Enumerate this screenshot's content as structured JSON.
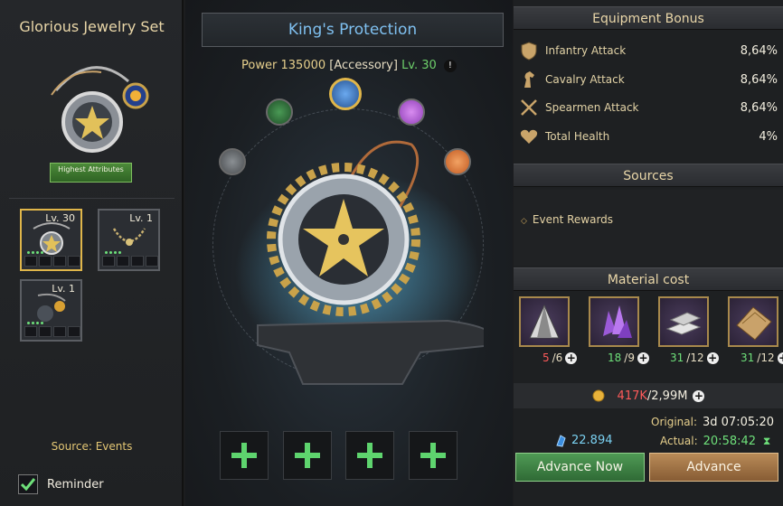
{
  "left_panel": {
    "title": "Glorious Jewelry Set",
    "badge": "Highest Attributes",
    "slots": [
      {
        "level": "Lv. 30",
        "active": true
      },
      {
        "level": "Lv. 1",
        "active": false
      },
      {
        "level": "Lv. 1",
        "active": false
      }
    ],
    "source": "Source: Events",
    "reminder_label": "Reminder",
    "reminder_checked": true
  },
  "center_panel": {
    "item_name": "King's Protection",
    "power_label": "Power",
    "power_value": "135000",
    "category": "[Accessory]",
    "level": "Lv. 30",
    "info_icon": "!",
    "gems": [
      {
        "name": "bronze-star-gem",
        "color": "#6b6f73"
      },
      {
        "name": "green-star-gem",
        "color": "#2f6e3a"
      },
      {
        "name": "blue-star-gem",
        "color": "#3d7cc2"
      },
      {
        "name": "purple-gem",
        "color": "#b45fd6"
      },
      {
        "name": "orange-gem",
        "color": "#e07b3a"
      }
    ],
    "add_slots": 4
  },
  "right_panel": {
    "equipment_bonus_title": "Equipment Bonus",
    "bonuses": [
      {
        "icon": "shield-icon",
        "name": "Infantry Attack",
        "value": "8,64%"
      },
      {
        "icon": "horse-icon",
        "name": "Cavalry Attack",
        "value": "8,64%"
      },
      {
        "icon": "crossed-spears-icon",
        "name": "Spearmen Attack",
        "value": "8,64%"
      },
      {
        "icon": "heart-icon",
        "name": "Total Health",
        "value": "4%"
      }
    ],
    "sources_title": "Sources",
    "source_item": "Event Rewards",
    "material_title": "Material cost",
    "materials": [
      {
        "icon": "ore-icon",
        "have": "5",
        "need": "/6",
        "enough": false
      },
      {
        "icon": "crystal-icon",
        "have": "18",
        "need": "/9",
        "enough": true
      },
      {
        "icon": "silver-bar-icon",
        "have": "31",
        "need": "/12",
        "enough": true
      },
      {
        "icon": "leather-icon",
        "have": "31",
        "need": "/12",
        "enough": true
      }
    ],
    "gold_have": "417K",
    "gold_need": "/2,99M",
    "gem_count": "22.894",
    "original_label": "Original:",
    "original_time": "3d 07:05:20",
    "actual_label": "Actual:",
    "actual_time": "20:58:42",
    "advance_now_label": "Advance Now",
    "advance_label": "Advance"
  },
  "colors": {
    "accent_blue": "#7fc0f0",
    "gold": "#e6cf8c",
    "green": "#6ee07a",
    "red": "#ff5a5a"
  }
}
